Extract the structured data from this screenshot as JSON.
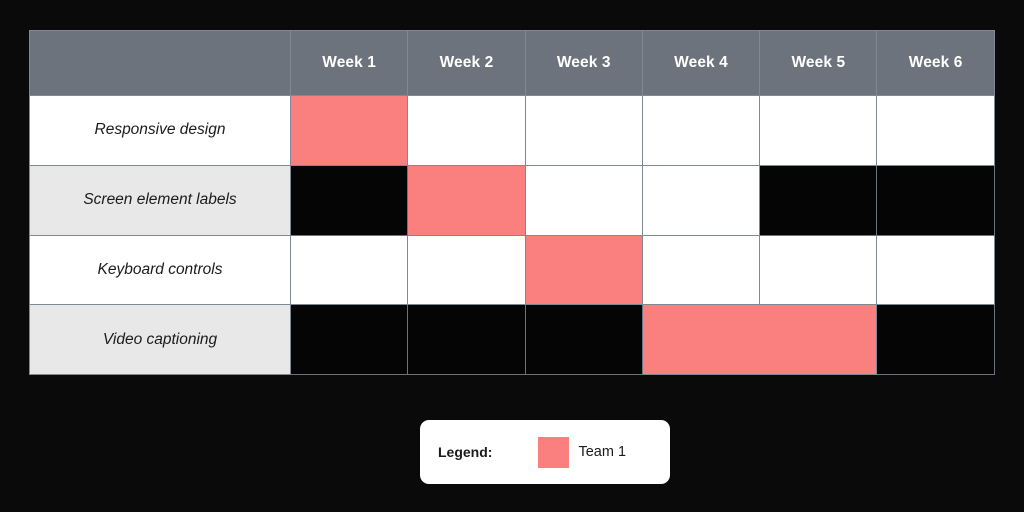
{
  "chart_data": {
    "type": "table",
    "title": "",
    "xlabel": "",
    "ylabel": "",
    "chart_kind": "gantt-grid",
    "corner_header": "",
    "categories": [
      "Week 1",
      "Week 2",
      "Week 3",
      "Week 4",
      "Week 5",
      "Week 6"
    ],
    "tasks": [
      "Responsive design",
      "Screen element labels",
      "Keyboard controls",
      "Video captioning"
    ],
    "series": [
      {
        "name": "Team 1",
        "color": "#fa7f7f",
        "bars": [
          {
            "task": "Responsive design",
            "start_week": "Week 1",
            "end_week": "Week 1",
            "span": 1
          },
          {
            "task": "Screen element labels",
            "start_week": "Week 2",
            "end_week": "Week 2",
            "span": 1
          },
          {
            "task": "Keyboard controls",
            "start_week": "Week 3",
            "end_week": "Week 3",
            "span": 1
          },
          {
            "task": "Video captioning",
            "start_week": "Week 4",
            "end_week": "Week 5",
            "span": 2
          }
        ]
      }
    ],
    "cells": [
      {
        "task": "Responsive design",
        "values": [
          "filled",
          "empty",
          "empty",
          "empty",
          "empty",
          "empty"
        ]
      },
      {
        "task": "Screen element labels",
        "values": [
          "dark",
          "filled",
          "empty",
          "empty",
          "dark",
          "dark"
        ]
      },
      {
        "task": "Keyboard controls",
        "values": [
          "empty",
          "empty",
          "filled",
          "empty",
          "empty",
          "empty"
        ]
      },
      {
        "task": "Video captioning",
        "values": [
          "dark",
          "dark",
          "dark",
          "filled",
          "filled",
          "dark"
        ]
      }
    ],
    "legend": {
      "position": "bottom-center",
      "title": "Legend:",
      "entries": [
        {
          "label": "Team 1",
          "color": "#fa7f7f"
        }
      ]
    },
    "grid": true,
    "colors": {
      "background": "#0a0a0a",
      "header_fill": "#6c737c",
      "header_text": "#ffffff",
      "row_odd": "#ffffff",
      "row_even": "#e8e8e8",
      "bar": "#fa7f7f",
      "border": "#808891",
      "empty_dark": "#050505"
    }
  },
  "table": {
    "corner_label": "",
    "columns": [
      "Week 1",
      "Week 2",
      "Week 3",
      "Week 4",
      "Week 5",
      "Week 6"
    ],
    "rows": [
      {
        "label": "Responsive design"
      },
      {
        "label": "Screen element labels"
      },
      {
        "label": "Keyboard controls"
      },
      {
        "label": "Video captioning"
      }
    ]
  },
  "legend": {
    "title": "Legend:",
    "entries": [
      {
        "label": "Team 1"
      }
    ]
  }
}
